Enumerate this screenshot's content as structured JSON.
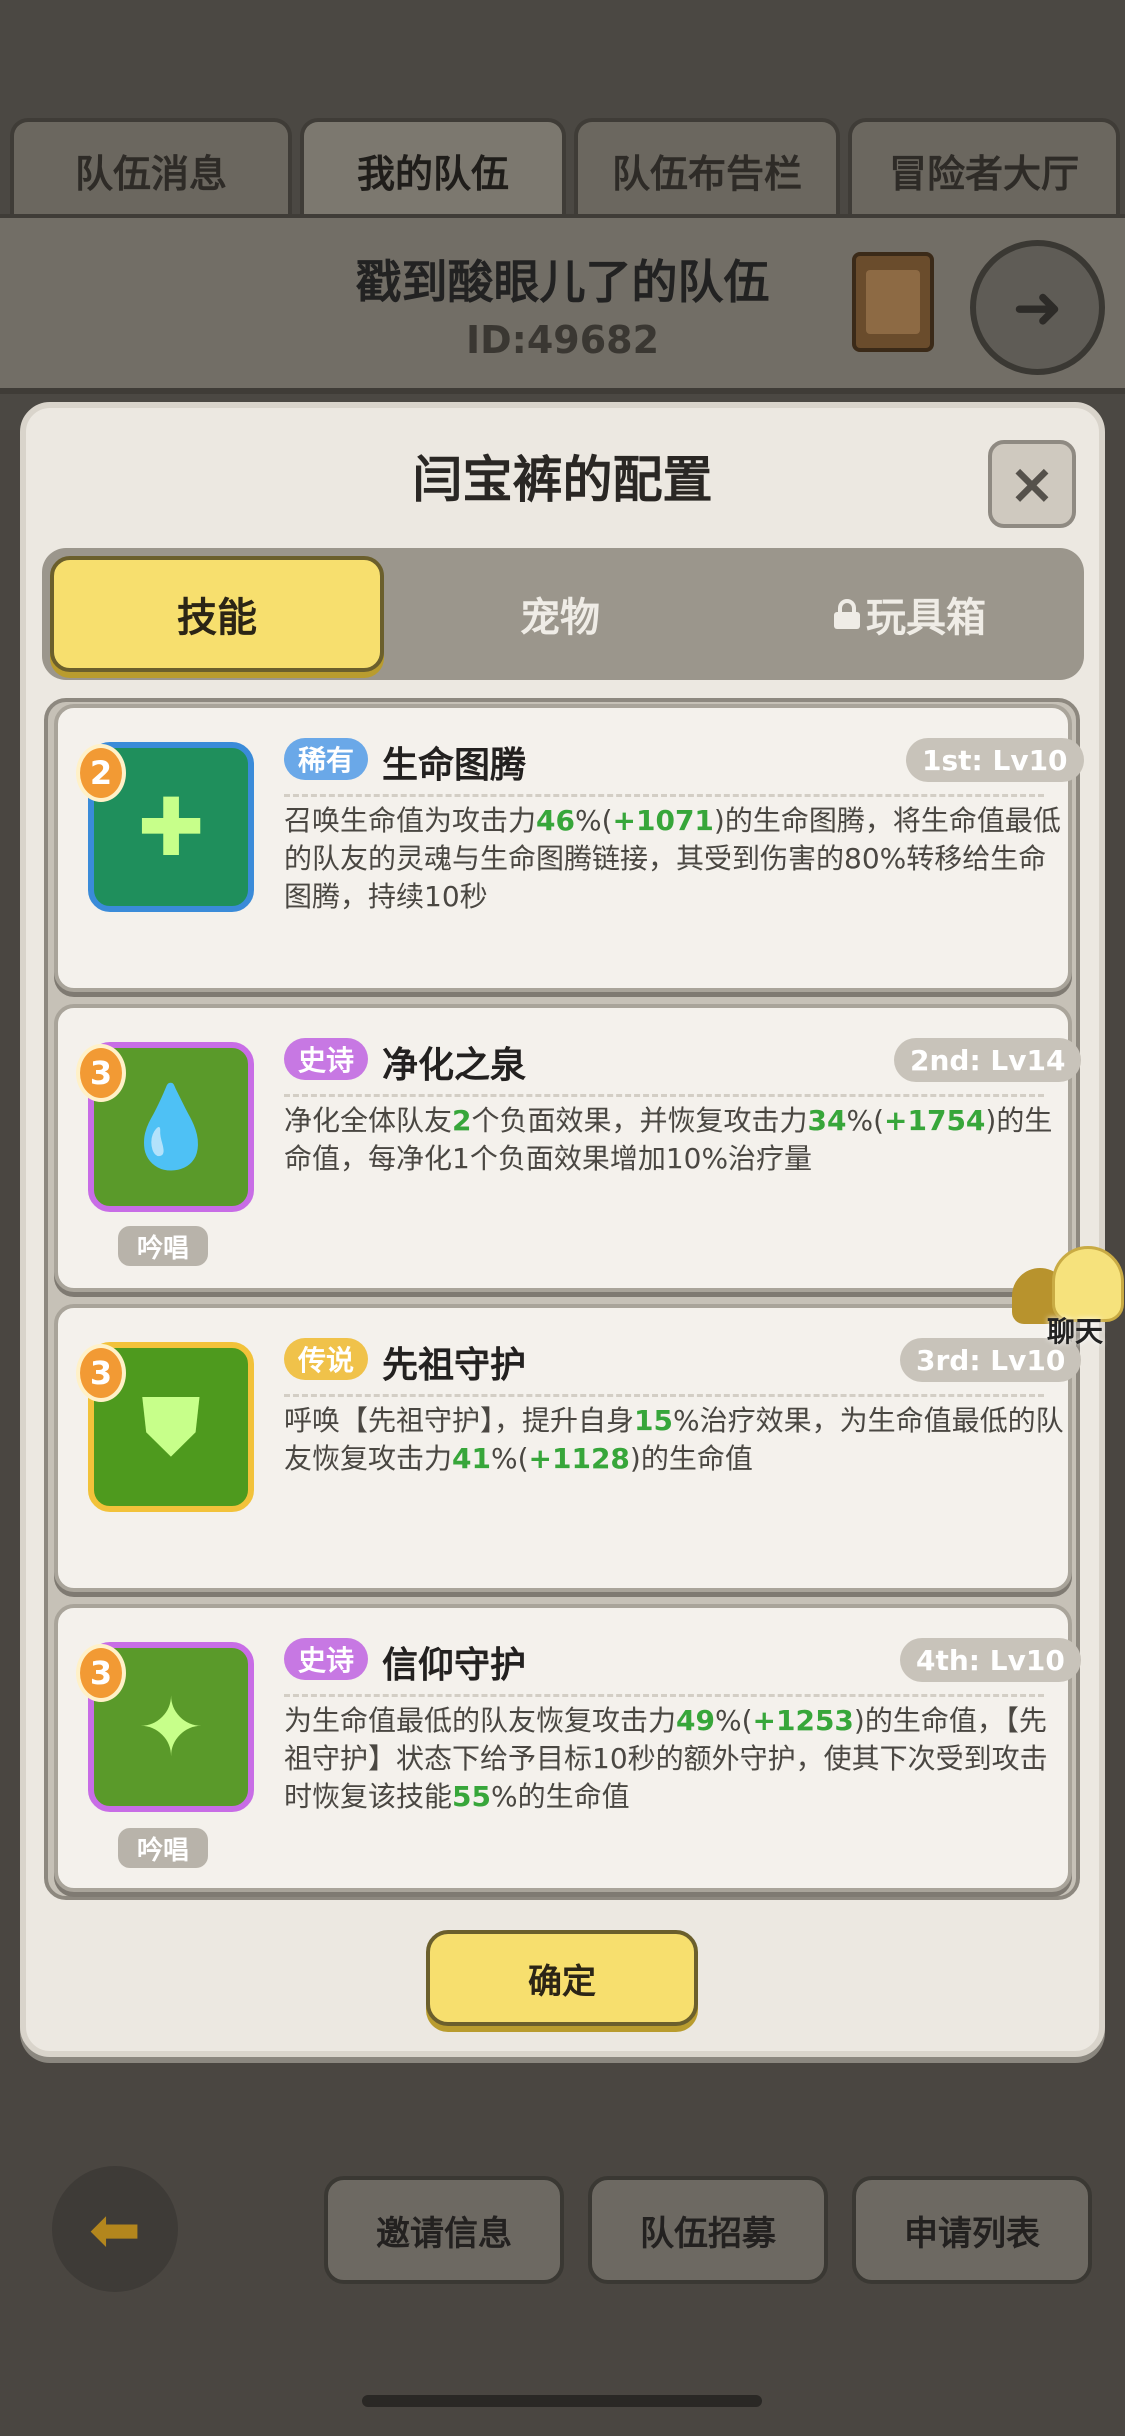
{
  "tabs": [
    {
      "label": "队伍消息"
    },
    {
      "label": "我的队伍"
    },
    {
      "label": "队伍布告栏"
    },
    {
      "label": "冒险者大厅"
    }
  ],
  "team": {
    "name": "戳到酸眼儿了的队伍",
    "id": "ID:49682"
  },
  "modal": {
    "title": "闫宝裤的配置",
    "close_icon": "×",
    "segments": {
      "skill": "技能",
      "pet": "宠物",
      "toy": "玩具箱"
    },
    "confirm": "确定"
  },
  "skills": [
    {
      "level_badge": "2",
      "rarity": "稀有",
      "rarity_color": "#6aa8e8",
      "name": "生命图腾",
      "slot": "1st: Lv10",
      "icon": "totem-icon",
      "chant": "",
      "desc": [
        {
          "t": "召唤生命值为攻击力"
        },
        {
          "t": "46",
          "g": true
        },
        {
          "t": "%("
        },
        {
          "t": "+1071",
          "g": true
        },
        {
          "t": ")的生命图腾，将生命值最低的队友的灵魂与生命图腾链接，其受到伤害的80%转移给生命图腾，持续10秒"
        }
      ]
    },
    {
      "level_badge": "3",
      "rarity": "史诗",
      "rarity_color": "#c778e3",
      "name": "净化之泉",
      "slot": "2nd: Lv14",
      "icon": "spring-icon",
      "chant": "吟唱",
      "desc": [
        {
          "t": "净化全体队友"
        },
        {
          "t": "2",
          "g": true
        },
        {
          "t": "个负面效果，并恢复攻击力"
        },
        {
          "t": "34",
          "g": true
        },
        {
          "t": "%("
        },
        {
          "t": "+1754",
          "g": true
        },
        {
          "t": ")的生命值，每净化1个负面效果增加10%治疗量"
        }
      ]
    },
    {
      "level_badge": "3",
      "rarity": "传说",
      "rarity_color": "#f0c24a",
      "name": "先祖守护",
      "slot": "3rd: Lv10",
      "icon": "ancestor-guard-icon",
      "chant": "",
      "desc": [
        {
          "t": "呼唤【先祖守护】，提升自身"
        },
        {
          "t": "15",
          "g": true
        },
        {
          "t": "%治疗效果，为生命值最低的队友恢复攻击力"
        },
        {
          "t": "41",
          "g": true
        },
        {
          "t": "%("
        },
        {
          "t": "+1128",
          "g": true
        },
        {
          "t": ")的生命值"
        }
      ]
    },
    {
      "level_badge": "3",
      "rarity": "史诗",
      "rarity_color": "#c778e3",
      "name": "信仰守护",
      "slot": "4th: Lv10",
      "icon": "faith-guard-icon",
      "chant": "吟唱",
      "desc": [
        {
          "t": "为生命值最低的队友恢复攻击力"
        },
        {
          "t": "49",
          "g": true
        },
        {
          "t": "%("
        },
        {
          "t": "+1253",
          "g": true
        },
        {
          "t": ")的生命值，【先祖守护】状态下给予目标10秒的额外守护，使其下次受到攻击时恢复该技能"
        },
        {
          "t": "55",
          "g": true
        },
        {
          "t": "%的生命值"
        }
      ]
    }
  ],
  "chat": {
    "label": "聊天"
  },
  "bottom": {
    "invite": "邀请信息",
    "recruit": "队伍招募",
    "apply_list": "申请列表"
  }
}
